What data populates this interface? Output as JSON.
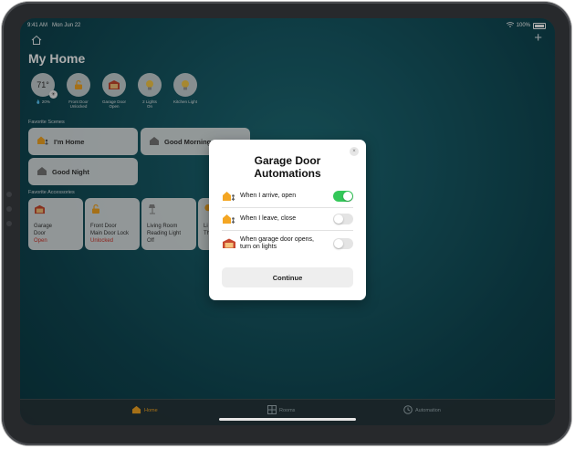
{
  "status_bar": {
    "time": "9:41 AM",
    "date": "Mon Jun 22",
    "battery": "100%"
  },
  "home": {
    "title": "My Home",
    "status_items": [
      {
        "value": "71°",
        "sub": "💧 20%"
      },
      {
        "sub": "Front Door\nUnlocked"
      },
      {
        "sub": "Garage Door\nOpen"
      },
      {
        "sub": "2 Lights\nOn"
      },
      {
        "sub": "Kitchen Light"
      }
    ],
    "scenes_label": "Favorite Scenes",
    "scenes": [
      {
        "label": "I'm Home"
      },
      {
        "label": "Good Morning"
      },
      {
        "label": "Good Night"
      }
    ],
    "accessories_label": "Favorite Accessories",
    "accessories": [
      {
        "name": "Garage\nDoor",
        "state": "Open"
      },
      {
        "name": "Front Door\nMain Door Lock",
        "state": "Unlocked"
      },
      {
        "name": "Living Room\nReading Light",
        "state": "Off"
      },
      {
        "name": "Li\nTh",
        "state": ""
      }
    ]
  },
  "tabs": [
    {
      "label": "Home",
      "icon": "house-icon",
      "active": true
    },
    {
      "label": "Rooms",
      "icon": "rooms-icon",
      "active": false
    },
    {
      "label": "Automation",
      "icon": "clock-icon",
      "active": false
    }
  ],
  "modal": {
    "title": "Garage Door\nAutomations",
    "close": "×",
    "rows": [
      {
        "label": "When I arrive, open",
        "icon": "arrive-icon",
        "enabled": true
      },
      {
        "label": "When I leave, close",
        "icon": "leave-icon",
        "enabled": false
      },
      {
        "label": "When garage door opens,\nturn on lights",
        "icon": "garage-icon",
        "enabled": false
      }
    ],
    "continue": "Continue"
  },
  "colors": {
    "accent": "#f4a623",
    "toggle_on": "#34c759",
    "danger": "#d0352b"
  }
}
